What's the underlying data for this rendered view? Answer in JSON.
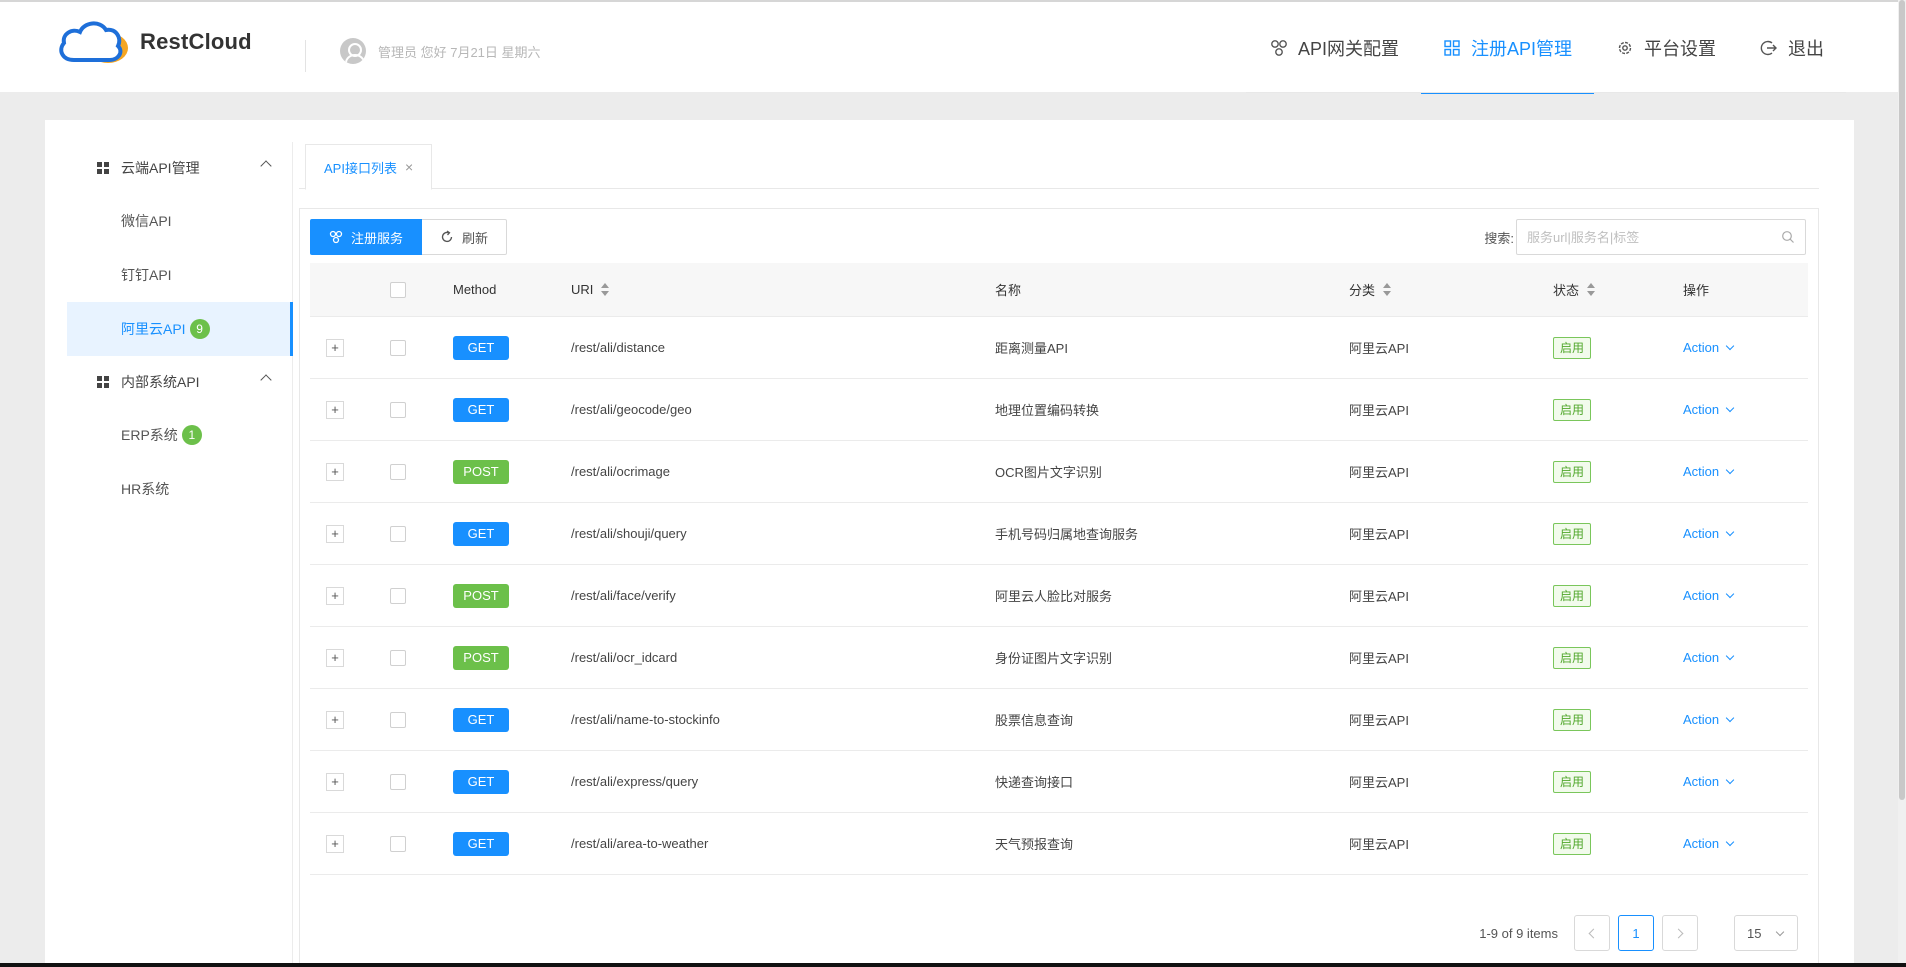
{
  "header": {
    "logo_text": "RestCloud",
    "user_greeting": "管理员 您好 7月21日 星期六",
    "nav": [
      {
        "label": "API网关配置",
        "icon": "gateway-icon"
      },
      {
        "label": "注册API管理",
        "icon": "grid-icon",
        "active": true
      },
      {
        "label": "平台设置",
        "icon": "gear-icon"
      },
      {
        "label": "退出",
        "icon": "logout-icon"
      }
    ]
  },
  "sidebar": {
    "groups": [
      {
        "label": "云端API管理",
        "items": [
          {
            "label": "微信API",
            "badge": null
          },
          {
            "label": "钉钉API",
            "badge": null
          },
          {
            "label": "阿里云API",
            "badge": "9",
            "active": true
          }
        ]
      },
      {
        "label": "内部系统API",
        "items": [
          {
            "label": "ERP系统",
            "badge": "1"
          },
          {
            "label": "HR系统",
            "badge": null
          }
        ]
      }
    ]
  },
  "tabs": [
    {
      "label": "API接口列表",
      "close": "×"
    }
  ],
  "toolbar": {
    "register_label": "注册服务",
    "refresh_label": "刷新"
  },
  "search": {
    "label": "搜索:",
    "placeholder": "服务url|服务名|标签"
  },
  "table": {
    "columns": {
      "method": "Method",
      "uri": "URI",
      "name": "名称",
      "category": "分类",
      "status": "状态",
      "action": "操作"
    },
    "expand_symbol": "+",
    "action_label": "Action",
    "rows": [
      {
        "method": "GET",
        "uri": "/rest/ali/distance",
        "name": "距离测量API",
        "category": "阿里云API",
        "status": "启用"
      },
      {
        "method": "GET",
        "uri": "/rest/ali/geocode/geo",
        "name": "地理位置编码转换",
        "category": "阿里云API",
        "status": "启用"
      },
      {
        "method": "POST",
        "uri": "/rest/ali/ocrimage",
        "name": "OCR图片文字识别",
        "category": "阿里云API",
        "status": "启用"
      },
      {
        "method": "GET",
        "uri": "/rest/ali/shouji/query",
        "name": "手机号码归属地查询服务",
        "category": "阿里云API",
        "status": "启用"
      },
      {
        "method": "POST",
        "uri": "/rest/ali/face/verify",
        "name": "阿里云人脸比对服务",
        "category": "阿里云API",
        "status": "启用"
      },
      {
        "method": "POST",
        "uri": "/rest/ali/ocr_idcard",
        "name": "身份证图片文字识别",
        "category": "阿里云API",
        "status": "启用"
      },
      {
        "method": "GET",
        "uri": "/rest/ali/name-to-stockinfo",
        "name": "股票信息查询",
        "category": "阿里云API",
        "status": "启用"
      },
      {
        "method": "GET",
        "uri": "/rest/ali/express/query",
        "name": "快递查询接口",
        "category": "阿里云API",
        "status": "启用"
      },
      {
        "method": "GET",
        "uri": "/rest/ali/area-to-weather",
        "name": "天气预报查询",
        "category": "阿里云API",
        "status": "启用"
      }
    ]
  },
  "pagination": {
    "total_text": "1-9 of 9 items",
    "current_page": "1",
    "page_size": "15"
  },
  "colors": {
    "primary": "#1890ff",
    "get": "#1890ff",
    "post": "#6cc04a",
    "status_border": "#7ac65b"
  }
}
